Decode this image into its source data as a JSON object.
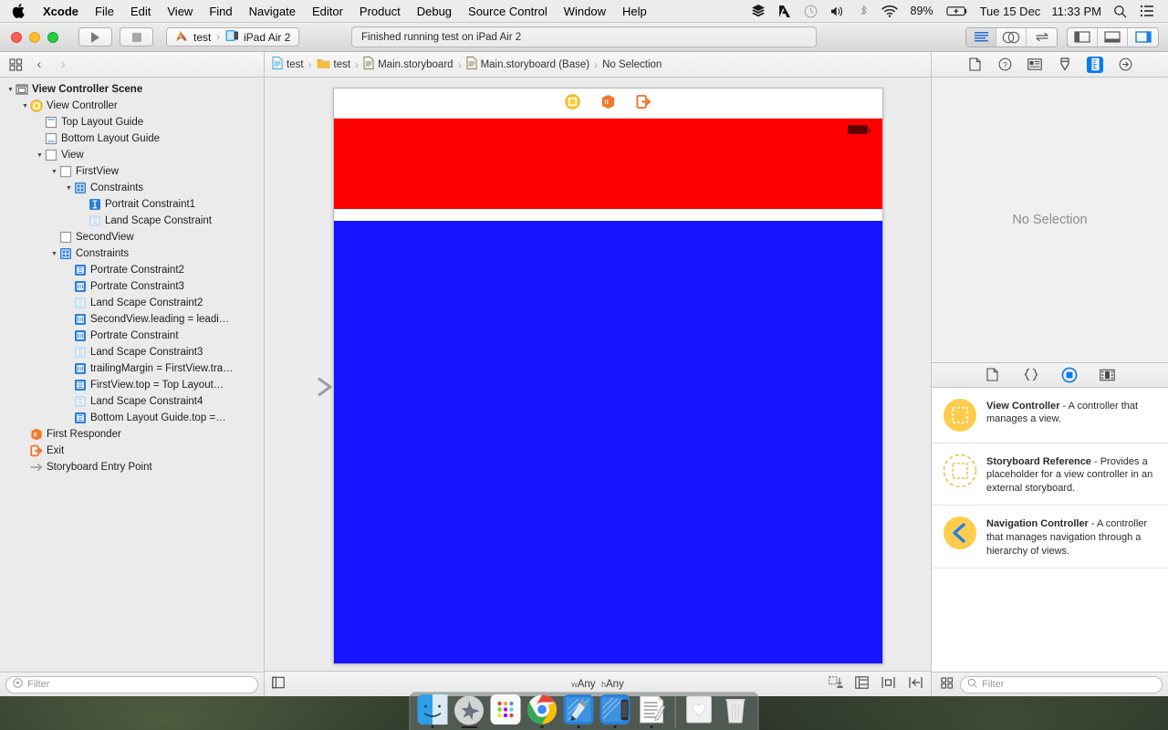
{
  "menubar": {
    "apple_icon": "apple-logo-icon",
    "items": [
      {
        "label": "Xcode",
        "bold": true
      },
      {
        "label": "File",
        "bold": false
      },
      {
        "label": "Edit",
        "bold": false
      },
      {
        "label": "View",
        "bold": false
      },
      {
        "label": "Find",
        "bold": false
      },
      {
        "label": "Navigate",
        "bold": false
      },
      {
        "label": "Editor",
        "bold": false
      },
      {
        "label": "Product",
        "bold": false
      },
      {
        "label": "Debug",
        "bold": false
      },
      {
        "label": "Source Control",
        "bold": false
      },
      {
        "label": "Window",
        "bold": false
      },
      {
        "label": "Help",
        "bold": false
      }
    ],
    "status": {
      "battery_percent": "89%",
      "date": "Tue 15 Dec",
      "time": "11:33 PM",
      "icons": [
        "stack-icon",
        "adobe-icon",
        "clock-icon",
        "volume-icon",
        "bluetooth-icon",
        "wifi-icon",
        "battery-charging-icon",
        "search-icon",
        "control-center-icon"
      ]
    }
  },
  "toolbar": {
    "run_icon": "play-icon",
    "stop_icon": "stop-icon",
    "scheme_name": "test",
    "scheme_separator": "›",
    "destination": "iPad Air 2",
    "status_message": "Finished running test on iPad Air 2",
    "editor_modes": [
      "standard-editor-icon",
      "assistant-editor-icon",
      "version-editor-icon"
    ],
    "view_toggles": [
      "navigator-toggle-icon",
      "debug-area-toggle-icon",
      "utilities-toggle-icon"
    ],
    "active_view_toggle": "utilities-toggle-icon"
  },
  "jumpbar": {
    "related_items_icon": "related-items-icon",
    "back_icon": "chevron-left-icon",
    "forward_icon": "chevron-right-icon",
    "crumbs": [
      {
        "label": "test",
        "icon": "project-file-icon"
      },
      {
        "label": "test",
        "icon": "folder-icon"
      },
      {
        "label": "Main.storyboard",
        "icon": "storyboard-file-icon"
      },
      {
        "label": "Main.storyboard (Base)",
        "icon": "storyboard-file-icon"
      },
      {
        "label": "No Selection",
        "icon": "none"
      }
    ]
  },
  "navigator": {
    "tree": [
      {
        "label": "View Controller Scene",
        "indent": 0,
        "disclosure": "open",
        "icon": "scene-icon",
        "bold": true
      },
      {
        "label": "View Controller",
        "indent": 1,
        "disclosure": "open",
        "icon": "view-controller-icon",
        "bold": false
      },
      {
        "label": "Top Layout Guide",
        "indent": 2,
        "disclosure": "none",
        "icon": "top-layout-guide-icon",
        "bold": false
      },
      {
        "label": "Bottom Layout Guide",
        "indent": 2,
        "disclosure": "none",
        "icon": "bottom-layout-guide-icon",
        "bold": false
      },
      {
        "label": "View",
        "indent": 2,
        "disclosure": "open",
        "icon": "view-icon",
        "bold": false
      },
      {
        "label": "FirstView",
        "indent": 3,
        "disclosure": "open",
        "icon": "view-icon",
        "bold": false
      },
      {
        "label": "Constraints",
        "indent": 4,
        "disclosure": "open",
        "icon": "constraints-folder-icon",
        "bold": false
      },
      {
        "label": "Portrait Constraint1",
        "indent": 5,
        "disclosure": "none",
        "icon": "constraint-active-icon",
        "bold": false
      },
      {
        "label": "Land Scape Constraint",
        "indent": 5,
        "disclosure": "none",
        "icon": "constraint-inactive-icon",
        "bold": false
      },
      {
        "label": "SecondView",
        "indent": 3,
        "disclosure": "none",
        "icon": "view-icon",
        "bold": false
      },
      {
        "label": "Constraints",
        "indent": 3,
        "disclosure": "open",
        "icon": "constraints-folder-icon",
        "bold": false
      },
      {
        "label": "Portrate Constraint2",
        "indent": 4,
        "disclosure": "none",
        "icon": "constraint-vertical-icon",
        "bold": false
      },
      {
        "label": "Portrate Constraint3",
        "indent": 4,
        "disclosure": "none",
        "icon": "constraint-horizontal-icon",
        "bold": false
      },
      {
        "label": "Land Scape Constraint2",
        "indent": 4,
        "disclosure": "none",
        "icon": "constraint-inactive-icon",
        "bold": false
      },
      {
        "label": "SecondView.leading = leadi…",
        "indent": 4,
        "disclosure": "none",
        "icon": "constraint-horizontal-icon",
        "bold": false
      },
      {
        "label": "Portrate Constraint",
        "indent": 4,
        "disclosure": "none",
        "icon": "constraint-horizontal-icon",
        "bold": false
      },
      {
        "label": "Land Scape Constraint3",
        "indent": 4,
        "disclosure": "none",
        "icon": "constraint-inactive-icon",
        "bold": false
      },
      {
        "label": "trailingMargin = FirstView.tra…",
        "indent": 4,
        "disclosure": "none",
        "icon": "constraint-horizontal-icon",
        "bold": false
      },
      {
        "label": "FirstView.top = Top Layout…",
        "indent": 4,
        "disclosure": "none",
        "icon": "constraint-vertical-icon",
        "bold": false
      },
      {
        "label": "Land Scape Constraint4",
        "indent": 4,
        "disclosure": "none",
        "icon": "constraint-inactive-icon",
        "bold": false
      },
      {
        "label": "Bottom Layout Guide.top =…",
        "indent": 4,
        "disclosure": "none",
        "icon": "constraint-vertical-icon",
        "bold": false
      },
      {
        "label": "First Responder",
        "indent": 1,
        "disclosure": "none",
        "icon": "first-responder-icon",
        "bold": false
      },
      {
        "label": "Exit",
        "indent": 1,
        "disclosure": "none",
        "icon": "exit-icon",
        "bold": false
      },
      {
        "label": "Storyboard Entry Point",
        "indent": 1,
        "disclosure": "none",
        "icon": "entry-point-arrow-icon",
        "bold": false
      }
    ],
    "filter_placeholder": "Filter"
  },
  "canvas": {
    "scene_dock_icons": [
      "view-controller-icon",
      "first-responder-icon",
      "exit-icon"
    ],
    "views": {
      "first_view_color": "#ff0000",
      "second_view_color": "#1414ff",
      "background_color": "#ffffff"
    },
    "status_bar_battery_icon": "battery-icon",
    "entry_point_icon": "entry-point-arrow-icon",
    "bottom": {
      "expand_icon": "document-outline-toggle-icon",
      "size_class_w_prefix": "w",
      "size_class_w_value": "Any",
      "size_class_h_prefix": "h",
      "size_class_h_value": "Any",
      "layout_buttons": [
        "update-frames-icon",
        "embed-in-icon",
        "align-icon",
        "pin-icon",
        "resolve-issues-icon"
      ]
    }
  },
  "utilities": {
    "inspector_tabs": [
      "file-inspector-icon",
      "quick-help-icon",
      "identity-inspector-icon",
      "attributes-inspector-icon",
      "size-inspector-icon",
      "connections-inspector-icon"
    ],
    "active_inspector_tab": "size-inspector-icon",
    "inspector_message": "No Selection",
    "library_tabs": [
      "file-template-library-icon",
      "code-snippet-library-icon",
      "object-library-icon",
      "media-library-icon"
    ],
    "active_library_tab": "object-library-icon",
    "library_items": [
      {
        "title": "View Controller",
        "description": " - A controller that manages a view.",
        "icon": "view-controller-library-icon"
      },
      {
        "title": "Storyboard Reference",
        "description": " - Provides a placeholder for a view controller in an external storyboard.",
        "icon": "storyboard-reference-library-icon"
      },
      {
        "title": "Navigation Controller",
        "description": " - A controller that manages navigation through a hierarchy of views.",
        "icon": "navigation-controller-library-icon"
      }
    ],
    "filter_placeholder": "Filter"
  },
  "dock": {
    "items": [
      {
        "name": "finder",
        "running": true
      },
      {
        "name": "launchpad",
        "running": false
      },
      {
        "name": "app-grid",
        "running": false
      },
      {
        "name": "google-chrome",
        "running": true
      },
      {
        "name": "xcode",
        "running": true
      },
      {
        "name": "xcode-beta",
        "running": true
      },
      {
        "name": "textedit",
        "running": true
      },
      {
        "name": "photos",
        "running": false
      },
      {
        "name": "trash",
        "running": false
      }
    ]
  },
  "colors": {
    "accent_blue": "#0b7bef",
    "library_yellow": "#ffcc4d",
    "first_view_red": "#ff0000",
    "second_view_blue": "#1414ff"
  }
}
